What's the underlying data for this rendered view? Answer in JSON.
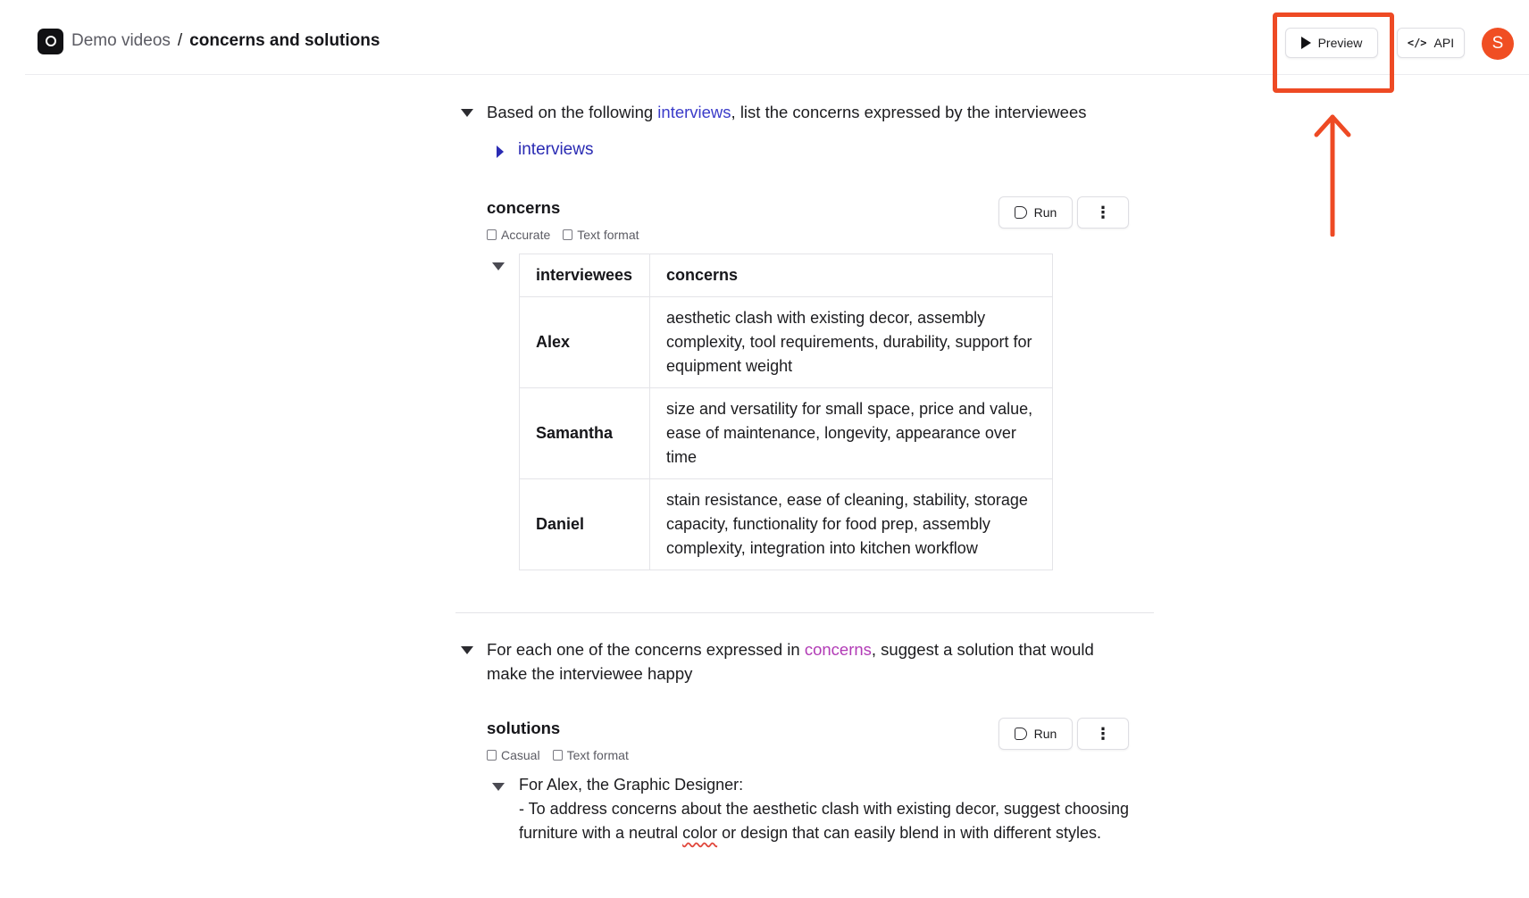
{
  "header": {
    "project": "Demo videos",
    "separator": "/",
    "page_title": "concerns and solutions",
    "preview_label": "Preview",
    "api_label": "API",
    "avatar_initial": "S"
  },
  "annotation": {
    "color": "#ee4a24"
  },
  "section1": {
    "prompt_before": "Based on the following ",
    "prompt_ref": "interviews",
    "prompt_after": ", list the concerns expressed by the interviewees",
    "input_label": "interviews",
    "output_name": "concerns",
    "tag_quality": "Accurate",
    "tag_format": "Text format",
    "run_label": "Run",
    "more_label": "⋮",
    "table": {
      "headers": [
        "interviewees",
        "concerns"
      ],
      "rows": [
        {
          "name": "Alex",
          "concerns": "aesthetic clash with existing decor, assembly complexity, tool requirements, durability, support for equipment weight"
        },
        {
          "name": "Samantha",
          "concerns": "size and versatility for small space, price and value, ease of maintenance, longevity, appearance over time"
        },
        {
          "name": "Daniel",
          "concerns": "stain resistance, ease of cleaning, stability, storage capacity, functionality for food prep, assembly complexity, integration into kitchen workflow"
        }
      ]
    }
  },
  "section2": {
    "prompt_before": "For each one of the concerns expressed in ",
    "prompt_ref": "concerns",
    "prompt_after": ", suggest a solution that would make the interviewee happy",
    "output_name": "solutions",
    "tag_quality": "Casual",
    "tag_format": "Text format",
    "run_label": "Run",
    "more_label": "⋮",
    "solution_line1": "For Alex, the Graphic Designer:",
    "solution_line2_before": "- To address concerns about the aesthetic clash with existing decor, suggest choosing furniture with a neutral ",
    "solution_line2_flag": "color",
    "solution_line2_after": " or design that can easily blend in with different styles."
  }
}
